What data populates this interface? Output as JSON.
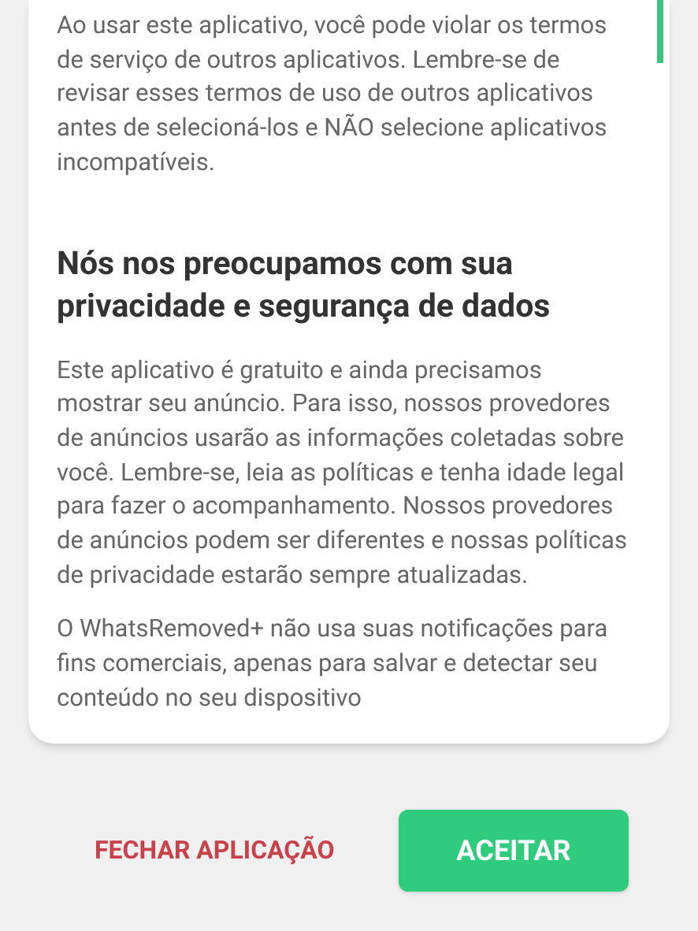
{
  "paragraphs_top": [
    "Ao usar este aplicativo, você pode violar os termos de serviço de outros aplicativos. Lembre-se de revisar esses termos de uso de outros aplicativos antes de selecioná-los e NÃO selecione aplicativos incompatíveis."
  ],
  "heading": "Nós nos preocupamos com sua privacidade e segurança de dados",
  "paragraphs": [
    "Este aplicativo é gratuito e ainda precisamos mostrar seu anúncio. Para isso, nossos provedores de anúncios usarão as informações coletadas sobre você. Lembre-se, leia as políticas e tenha idade legal para fazer o acompanhamento. Nossos provedores de anúncios podem ser diferentes e nossas políticas de privacidade estarão sempre atualizadas.",
    "O WhatsRemoved+ não usa suas notificações para fins comerciais, apenas para salvar e detectar seu conteúdo no seu dispositivo"
  ],
  "buttons": [
    {
      "kind": "text",
      "label": "FECHAR APLICAÇÃO"
    },
    {
      "kind": "filled",
      "label": "ACEITAR"
    }
  ]
}
